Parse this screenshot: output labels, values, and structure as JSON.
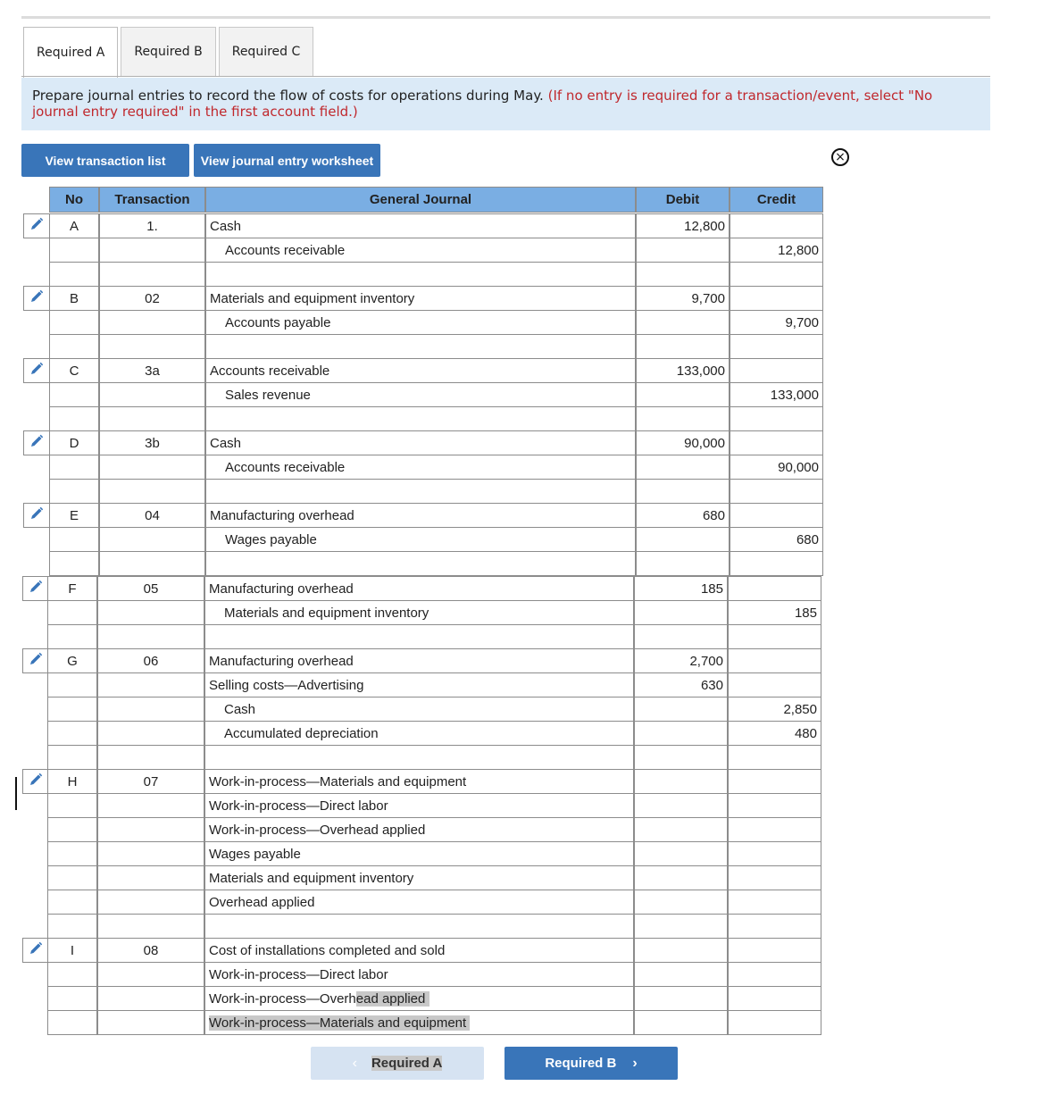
{
  "tabs": [
    {
      "label": "Required A",
      "active": true
    },
    {
      "label": "Required B",
      "active": false
    },
    {
      "label": "Required C",
      "active": false
    }
  ],
  "instructions": {
    "main": "Prepare journal entries to record the flow of costs for operations during May.",
    "note": "(If no entry is required for a transaction/event, select \"No journal entry required\" in the first account field.)"
  },
  "buttons": {
    "view_transactions": "View transaction list",
    "view_worksheet": "View journal entry worksheet"
  },
  "icons": {
    "close": "circled-x-icon",
    "edit": "pencil-icon"
  },
  "colors": {
    "header_bg": "#7aaee3",
    "button_blue": "#3975b9",
    "instructions_bg": "#dbeaf7",
    "note_red": "#c0282d",
    "edit_icon": "#3975b9"
  },
  "journal": {
    "headers": {
      "no": "No",
      "transaction": "Transaction",
      "account": "General Journal",
      "debit": "Debit",
      "credit": "Credit"
    },
    "entries": [
      {
        "no": "A",
        "transaction": "1.",
        "lines": [
          {
            "account": "Cash",
            "indent": false,
            "debit": "12,800",
            "credit": ""
          },
          {
            "account": "Accounts receivable",
            "indent": true,
            "debit": "",
            "credit": "12,800"
          },
          {
            "account": "",
            "indent": false,
            "debit": "",
            "credit": ""
          }
        ]
      },
      {
        "no": "B",
        "transaction": "02",
        "lines": [
          {
            "account": "Materials and equipment inventory",
            "indent": false,
            "debit": "9,700",
            "credit": ""
          },
          {
            "account": "Accounts payable",
            "indent": true,
            "debit": "",
            "credit": "9,700"
          },
          {
            "account": "",
            "indent": false,
            "debit": "",
            "credit": ""
          }
        ]
      },
      {
        "no": "C",
        "transaction": "3a",
        "lines": [
          {
            "account": "Accounts receivable",
            "indent": false,
            "debit": "133,000",
            "credit": ""
          },
          {
            "account": "Sales revenue",
            "indent": true,
            "debit": "",
            "credit": "133,000"
          },
          {
            "account": "",
            "indent": false,
            "debit": "",
            "credit": ""
          }
        ]
      },
      {
        "no": "D",
        "transaction": "3b",
        "lines": [
          {
            "account": "Cash",
            "indent": false,
            "debit": "90,000",
            "credit": ""
          },
          {
            "account": "Accounts receivable",
            "indent": true,
            "debit": "",
            "credit": "90,000"
          },
          {
            "account": "",
            "indent": false,
            "debit": "",
            "credit": ""
          }
        ]
      },
      {
        "no": "E",
        "transaction": "04",
        "lines": [
          {
            "account": "Manufacturing overhead",
            "indent": false,
            "debit": "680",
            "credit": ""
          },
          {
            "account": "Wages payable",
            "indent": true,
            "debit": "",
            "credit": "680"
          },
          {
            "account": "",
            "indent": false,
            "debit": "",
            "credit": ""
          }
        ]
      },
      {
        "no": "F",
        "transaction": "05",
        "lines": [
          {
            "account": "Manufacturing overhead",
            "indent": false,
            "debit": "185",
            "credit": ""
          },
          {
            "account": "Materials and equipment inventory",
            "indent": true,
            "debit": "",
            "credit": "185"
          },
          {
            "account": "",
            "indent": false,
            "debit": "",
            "credit": ""
          }
        ]
      },
      {
        "no": "G",
        "transaction": "06",
        "lines": [
          {
            "account": "Manufacturing overhead",
            "indent": false,
            "debit": "2,700",
            "credit": ""
          },
          {
            "account": "Selling costs—Advertising",
            "indent": false,
            "debit": "630",
            "credit": ""
          },
          {
            "account": "Cash",
            "indent": true,
            "debit": "",
            "credit": "2,850"
          },
          {
            "account": "Accumulated depreciation",
            "indent": true,
            "debit": "",
            "credit": "480"
          },
          {
            "account": "",
            "indent": false,
            "debit": "",
            "credit": ""
          }
        ]
      },
      {
        "no": "H",
        "transaction": "07",
        "lines": [
          {
            "account": "Work-in-process—Materials and equipment",
            "indent": false,
            "debit": "",
            "credit": ""
          },
          {
            "account": "Work-in-process—Direct labor",
            "indent": false,
            "debit": "",
            "credit": ""
          },
          {
            "account": "Work-in-process—Overhead applied",
            "indent": false,
            "debit": "",
            "credit": ""
          },
          {
            "account": "Wages payable",
            "indent": false,
            "debit": "",
            "credit": ""
          },
          {
            "account": "Materials and equipment inventory",
            "indent": false,
            "debit": "",
            "credit": ""
          },
          {
            "account": "Overhead applied",
            "indent": false,
            "debit": "",
            "credit": ""
          },
          {
            "account": "",
            "indent": false,
            "debit": "",
            "credit": ""
          }
        ]
      },
      {
        "no": "I",
        "transaction": "08",
        "lines": [
          {
            "account": "Cost of installations completed and sold",
            "indent": false,
            "debit": "",
            "credit": ""
          },
          {
            "account": "Work-in-process—Direct labor",
            "indent": false,
            "debit": "",
            "credit": ""
          },
          {
            "account": "Work-in-process—Overhead applied",
            "indent": false,
            "debit": "",
            "credit": "",
            "highlight_from": 21
          },
          {
            "account": "Work-in-process—Materials and equipment",
            "indent": false,
            "debit": "",
            "credit": "",
            "highlight_from": 0
          }
        ]
      }
    ]
  },
  "nav": {
    "prev_label": "Required A",
    "next_label": "Required B",
    "prev_chevron": "‹",
    "next_chevron": "›"
  }
}
